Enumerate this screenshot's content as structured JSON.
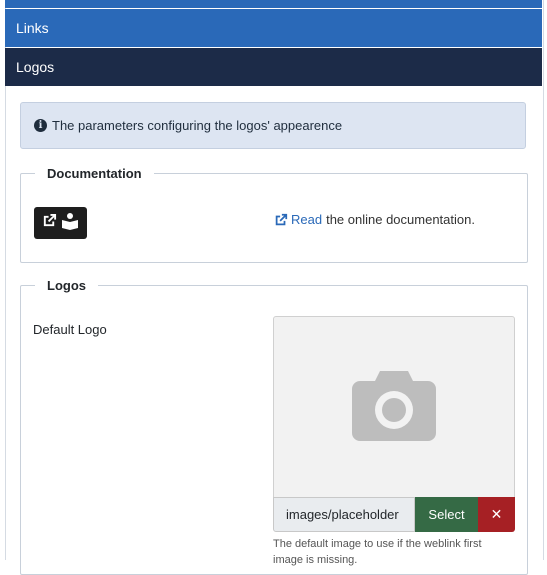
{
  "panels": {
    "links_label": "Links",
    "logos_label": "Logos"
  },
  "alert": {
    "icon": "info-icon",
    "text": "The parameters configuring the logos' appearence"
  },
  "documentation": {
    "legend": "Documentation",
    "link_label": "Read",
    "link_suffix": "the online documentation.",
    "badge_icons": [
      "external-link-icon",
      "book-reader-icon"
    ]
  },
  "logos": {
    "legend": "Logos",
    "default_logo_label": "Default Logo",
    "media_value": "images/placeholder",
    "select_label": "Select",
    "clear_label": "✕",
    "help_text": "The default image to use if the weblink first image is missing."
  },
  "colors": {
    "primary": "#2a69b8",
    "dark": "#1c2b48",
    "success": "#356a45",
    "danger": "#a62024"
  }
}
